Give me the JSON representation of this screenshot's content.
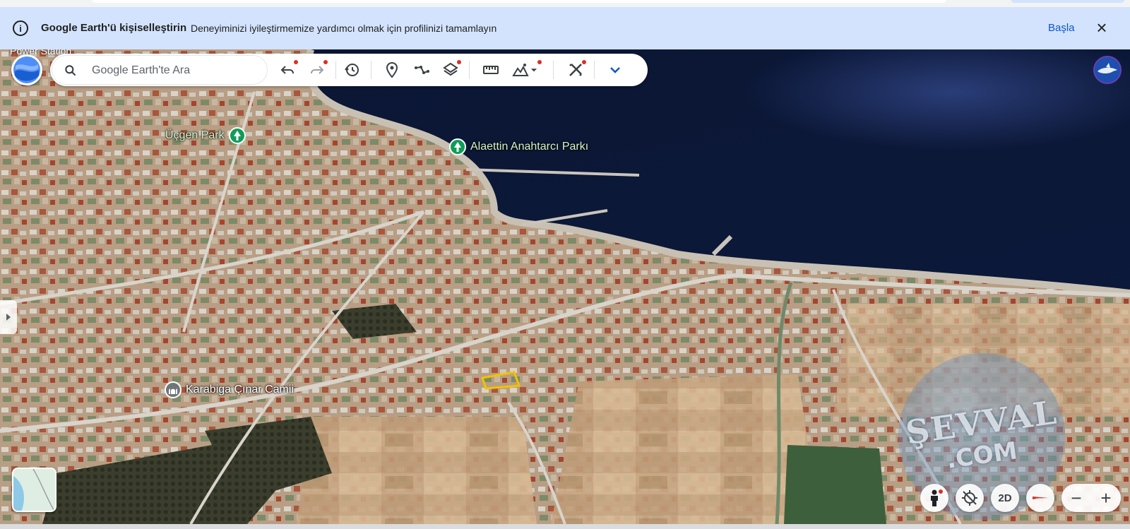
{
  "banner": {
    "title": "Google Earth'ü kişiselleştirin",
    "message": "Deneyiminizi iyileştirmemize yardımcı olmak için profilinizi tamamlayın",
    "start_label": "Başla",
    "close_label": "×"
  },
  "search": {
    "placeholder": "Google Earth'te Ara"
  },
  "map": {
    "labels": {
      "ucgen_park": "Üçgen Park",
      "alaettin_park": "Alaettin Anahtarcı Parkı",
      "karabiga_camii": "Karabiga Çınar Camii",
      "power_station": "Power Station"
    },
    "watermark_line1": "ŞEVVAL",
    "watermark_line2": ".COM"
  },
  "controls": {
    "mode_2d": "2D",
    "zoom_out": "−",
    "zoom_in": "+"
  },
  "colors": {
    "banner_bg": "#d3e3fd",
    "accent": "#0b57d0",
    "notify_dot": "#d93025",
    "sea": "#0d1a3c"
  }
}
